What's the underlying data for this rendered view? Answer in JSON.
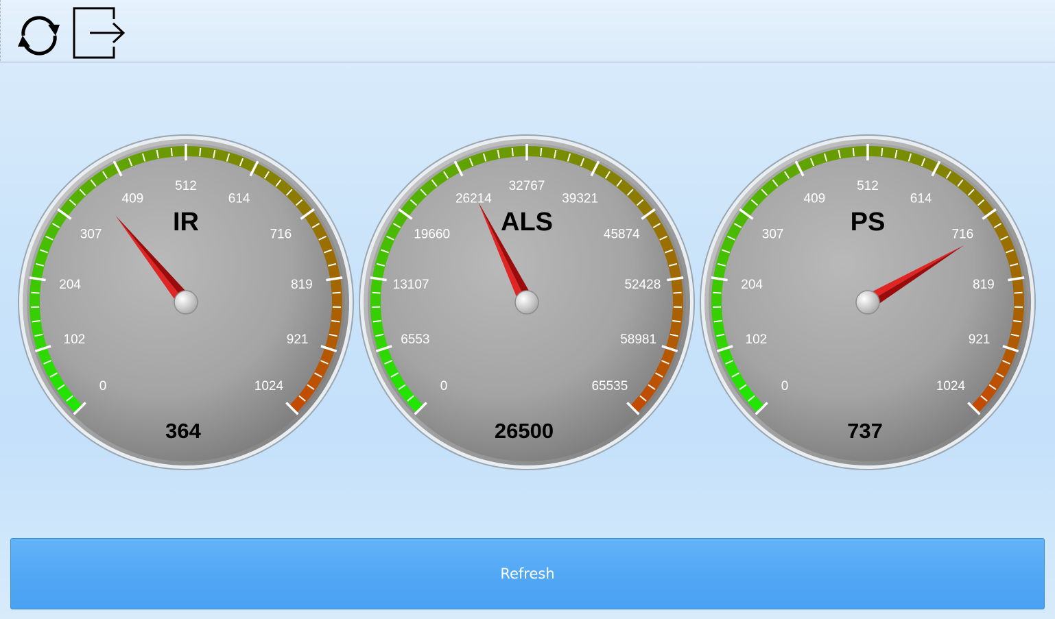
{
  "toolbar": {
    "refresh_icon": "refresh-icon",
    "exit_icon": "exit-icon"
  },
  "gauges": [
    {
      "title": "IR",
      "value": 364,
      "value_text": "364",
      "min": 0,
      "max": 1024,
      "tick_labels": [
        "0",
        "102",
        "204",
        "307",
        "409",
        "512",
        "614",
        "716",
        "819",
        "921",
        "1024"
      ]
    },
    {
      "title": "ALS",
      "value": 26500,
      "value_text": "26500",
      "min": 0,
      "max": 65535,
      "tick_labels": [
        "0",
        "6553",
        "13107",
        "19660",
        "26214",
        "32767",
        "39321",
        "45874",
        "52428",
        "58981",
        "65535"
      ]
    },
    {
      "title": "PS",
      "value": 737,
      "value_text": "737",
      "min": 0,
      "max": 1024,
      "tick_labels": [
        "0",
        "102",
        "204",
        "307",
        "409",
        "512",
        "614",
        "716",
        "819",
        "921",
        "1024"
      ]
    }
  ],
  "colors": {
    "arc_start": "#1ee800",
    "arc_mid": "#6f9400",
    "arc_end": "#c44a00",
    "needle": "#cc1010",
    "button": "#55a9f5"
  },
  "refresh_button": {
    "label": "Refresh"
  }
}
